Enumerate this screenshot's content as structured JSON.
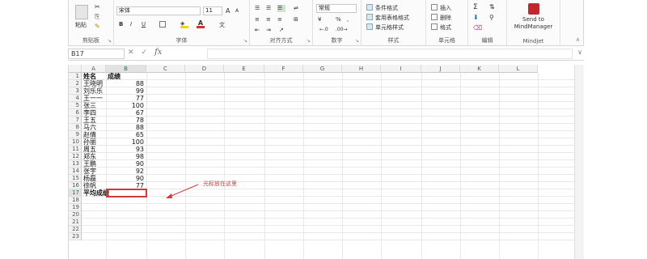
{
  "ribbon": {
    "clipboard": {
      "paste_label": "粘贴",
      "group_label": "剪贴板"
    },
    "font": {
      "name": "宋体",
      "size": "11",
      "grow": "A",
      "shrink": "A",
      "bold": "B",
      "italic": "I",
      "underline": "U",
      "group_label": "字体"
    },
    "alignment": {
      "group_label": "对齐方式"
    },
    "number": {
      "format": "常规",
      "percent": "%",
      "comma": ",",
      "group_label": "数字"
    },
    "styles": {
      "conditional": "条件格式",
      "table": "套用表格格式",
      "cell": "单元格样式",
      "group_label": "样式"
    },
    "cells": {
      "insert": "插入",
      "delete": "删除",
      "format": "格式",
      "group_label": "单元格"
    },
    "editing": {
      "sum": "Σ",
      "group_label": "编辑"
    },
    "mindjet": {
      "send_line1": "Send to",
      "send_line2": "MindManager",
      "group_label": "Mindjet"
    }
  },
  "formula_bar": {
    "name_box": "B17",
    "cancel": "✕",
    "confirm": "✓",
    "fx": "fx",
    "value": ""
  },
  "columns": [
    "A",
    "B",
    "C",
    "D",
    "E",
    "F",
    "G",
    "H",
    "I",
    "J",
    "K",
    "L"
  ],
  "rows": [
    "1",
    "2",
    "3",
    "4",
    "5",
    "6",
    "7",
    "8",
    "9",
    "10",
    "11",
    "12",
    "13",
    "14",
    "15",
    "16",
    "17",
    "18",
    "19",
    "20",
    "21",
    "22",
    "23"
  ],
  "sheet": {
    "header_a": "姓名",
    "header_b": "成绩",
    "names": [
      "王晓明",
      "刘乐乐",
      "王一一",
      "张三",
      "李四",
      "王五",
      "马六",
      "赵倩",
      "孙丽",
      "周五",
      "郑东",
      "王鹏",
      "张宇",
      "杨磊",
      "徐帆"
    ],
    "scores": [
      "88",
      "99",
      "77",
      "100",
      "67",
      "78",
      "88",
      "65",
      "100",
      "93",
      "98",
      "90",
      "92",
      "90",
      "77"
    ],
    "avg_label": "平均成绩"
  },
  "annotation": {
    "text": "光标放在这里",
    "color": "#d03a3a"
  },
  "colors": {
    "accent": "#217346",
    "selection": "#d03a3a",
    "header_bg": "#f3f3f3"
  }
}
